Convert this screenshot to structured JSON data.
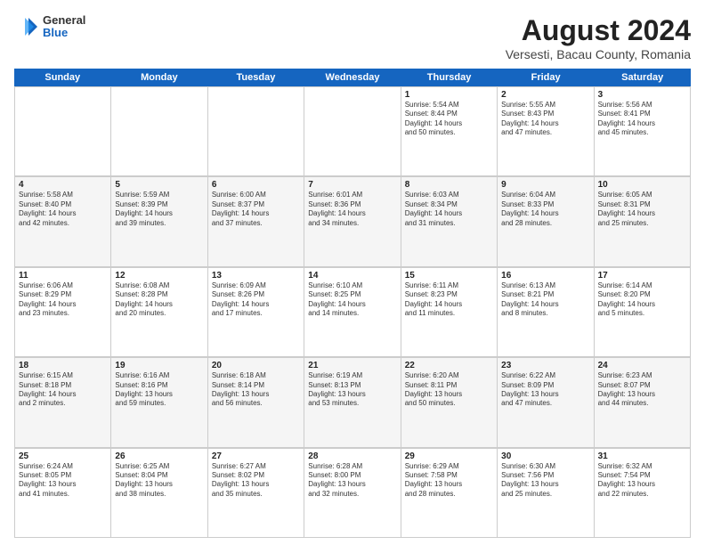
{
  "logo": {
    "general": "General",
    "blue": "Blue"
  },
  "header": {
    "title": "August 2024",
    "subtitle": "Versesti, Bacau County, Romania"
  },
  "weekdays": [
    "Sunday",
    "Monday",
    "Tuesday",
    "Wednesday",
    "Thursday",
    "Friday",
    "Saturday"
  ],
  "rows": [
    [
      {
        "day": "",
        "info": ""
      },
      {
        "day": "",
        "info": ""
      },
      {
        "day": "",
        "info": ""
      },
      {
        "day": "",
        "info": ""
      },
      {
        "day": "1",
        "info": "Sunrise: 5:54 AM\nSunset: 8:44 PM\nDaylight: 14 hours\nand 50 minutes."
      },
      {
        "day": "2",
        "info": "Sunrise: 5:55 AM\nSunset: 8:43 PM\nDaylight: 14 hours\nand 47 minutes."
      },
      {
        "day": "3",
        "info": "Sunrise: 5:56 AM\nSunset: 8:41 PM\nDaylight: 14 hours\nand 45 minutes."
      }
    ],
    [
      {
        "day": "4",
        "info": "Sunrise: 5:58 AM\nSunset: 8:40 PM\nDaylight: 14 hours\nand 42 minutes."
      },
      {
        "day": "5",
        "info": "Sunrise: 5:59 AM\nSunset: 8:39 PM\nDaylight: 14 hours\nand 39 minutes."
      },
      {
        "day": "6",
        "info": "Sunrise: 6:00 AM\nSunset: 8:37 PM\nDaylight: 14 hours\nand 37 minutes."
      },
      {
        "day": "7",
        "info": "Sunrise: 6:01 AM\nSunset: 8:36 PM\nDaylight: 14 hours\nand 34 minutes."
      },
      {
        "day": "8",
        "info": "Sunrise: 6:03 AM\nSunset: 8:34 PM\nDaylight: 14 hours\nand 31 minutes."
      },
      {
        "day": "9",
        "info": "Sunrise: 6:04 AM\nSunset: 8:33 PM\nDaylight: 14 hours\nand 28 minutes."
      },
      {
        "day": "10",
        "info": "Sunrise: 6:05 AM\nSunset: 8:31 PM\nDaylight: 14 hours\nand 25 minutes."
      }
    ],
    [
      {
        "day": "11",
        "info": "Sunrise: 6:06 AM\nSunset: 8:29 PM\nDaylight: 14 hours\nand 23 minutes."
      },
      {
        "day": "12",
        "info": "Sunrise: 6:08 AM\nSunset: 8:28 PM\nDaylight: 14 hours\nand 20 minutes."
      },
      {
        "day": "13",
        "info": "Sunrise: 6:09 AM\nSunset: 8:26 PM\nDaylight: 14 hours\nand 17 minutes."
      },
      {
        "day": "14",
        "info": "Sunrise: 6:10 AM\nSunset: 8:25 PM\nDaylight: 14 hours\nand 14 minutes."
      },
      {
        "day": "15",
        "info": "Sunrise: 6:11 AM\nSunset: 8:23 PM\nDaylight: 14 hours\nand 11 minutes."
      },
      {
        "day": "16",
        "info": "Sunrise: 6:13 AM\nSunset: 8:21 PM\nDaylight: 14 hours\nand 8 minutes."
      },
      {
        "day": "17",
        "info": "Sunrise: 6:14 AM\nSunset: 8:20 PM\nDaylight: 14 hours\nand 5 minutes."
      }
    ],
    [
      {
        "day": "18",
        "info": "Sunrise: 6:15 AM\nSunset: 8:18 PM\nDaylight: 14 hours\nand 2 minutes."
      },
      {
        "day": "19",
        "info": "Sunrise: 6:16 AM\nSunset: 8:16 PM\nDaylight: 13 hours\nand 59 minutes."
      },
      {
        "day": "20",
        "info": "Sunrise: 6:18 AM\nSunset: 8:14 PM\nDaylight: 13 hours\nand 56 minutes."
      },
      {
        "day": "21",
        "info": "Sunrise: 6:19 AM\nSunset: 8:13 PM\nDaylight: 13 hours\nand 53 minutes."
      },
      {
        "day": "22",
        "info": "Sunrise: 6:20 AM\nSunset: 8:11 PM\nDaylight: 13 hours\nand 50 minutes."
      },
      {
        "day": "23",
        "info": "Sunrise: 6:22 AM\nSunset: 8:09 PM\nDaylight: 13 hours\nand 47 minutes."
      },
      {
        "day": "24",
        "info": "Sunrise: 6:23 AM\nSunset: 8:07 PM\nDaylight: 13 hours\nand 44 minutes."
      }
    ],
    [
      {
        "day": "25",
        "info": "Sunrise: 6:24 AM\nSunset: 8:05 PM\nDaylight: 13 hours\nand 41 minutes."
      },
      {
        "day": "26",
        "info": "Sunrise: 6:25 AM\nSunset: 8:04 PM\nDaylight: 13 hours\nand 38 minutes."
      },
      {
        "day": "27",
        "info": "Sunrise: 6:27 AM\nSunset: 8:02 PM\nDaylight: 13 hours\nand 35 minutes."
      },
      {
        "day": "28",
        "info": "Sunrise: 6:28 AM\nSunset: 8:00 PM\nDaylight: 13 hours\nand 32 minutes."
      },
      {
        "day": "29",
        "info": "Sunrise: 6:29 AM\nSunset: 7:58 PM\nDaylight: 13 hours\nand 28 minutes."
      },
      {
        "day": "30",
        "info": "Sunrise: 6:30 AM\nSunset: 7:56 PM\nDaylight: 13 hours\nand 25 minutes."
      },
      {
        "day": "31",
        "info": "Sunrise: 6:32 AM\nSunset: 7:54 PM\nDaylight: 13 hours\nand 22 minutes."
      }
    ]
  ]
}
